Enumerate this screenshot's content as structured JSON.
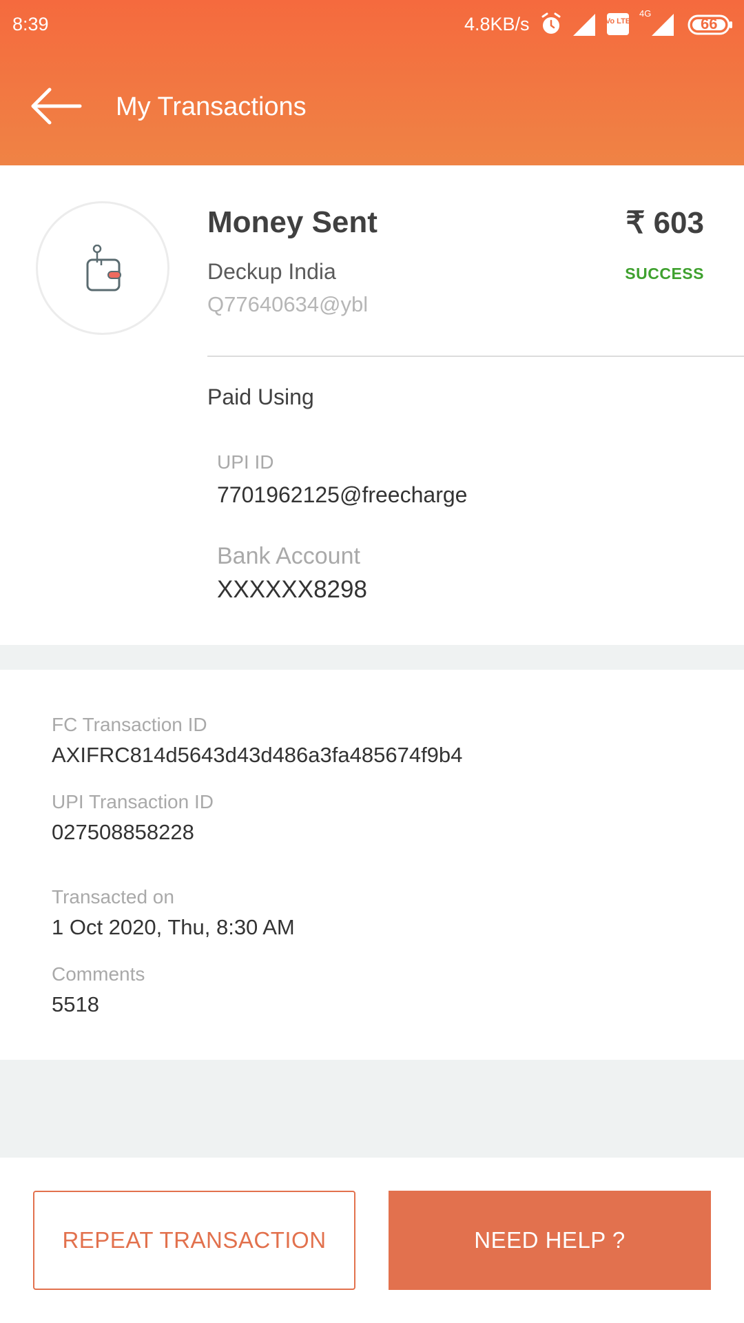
{
  "status_bar": {
    "time": "8:39",
    "network_speed": "4.8KB/s",
    "volte_label": "Vo LTE",
    "network_type": "4G",
    "battery": "66",
    "icons": [
      "alarm-icon",
      "signal-icon",
      "volte-icon",
      "signal-4g-icon",
      "battery-icon"
    ]
  },
  "app_bar": {
    "title": "My Transactions",
    "back_icon": "arrow-left-icon"
  },
  "summary": {
    "avatar_icon": "wallet-icon",
    "title": "Money Sent",
    "amount": "₹ 603",
    "payee_name": "Deckup India",
    "payee_vpa": "Q77640634@ybl",
    "status": "SUCCESS"
  },
  "paid_using": {
    "heading": "Paid Using",
    "upi_label": "UPI ID",
    "upi_value": "7701962125@freecharge",
    "bank_label": "Bank Account",
    "bank_value": "XXXXXX8298"
  },
  "details": {
    "fc_txn_label": "FC Transaction ID",
    "fc_txn_value": "AXIFRC814d5643d43d486a3fa485674f9b4",
    "upi_txn_label": "UPI Transaction ID",
    "upi_txn_value": "027508858228",
    "date_label": "Transacted on",
    "date_value": "1 Oct 2020, Thu, 8:30 AM",
    "comments_label": "Comments",
    "comments_value": "5518"
  },
  "actions": {
    "repeat_label": "REPEAT TRANSACTION",
    "help_label": "NEED HELP ?"
  },
  "colors": {
    "header_top": "#f56a3e",
    "header_bottom": "#ef8345",
    "accent": "#e2714e",
    "success": "#3fa12f",
    "band": "#eff2f2"
  }
}
